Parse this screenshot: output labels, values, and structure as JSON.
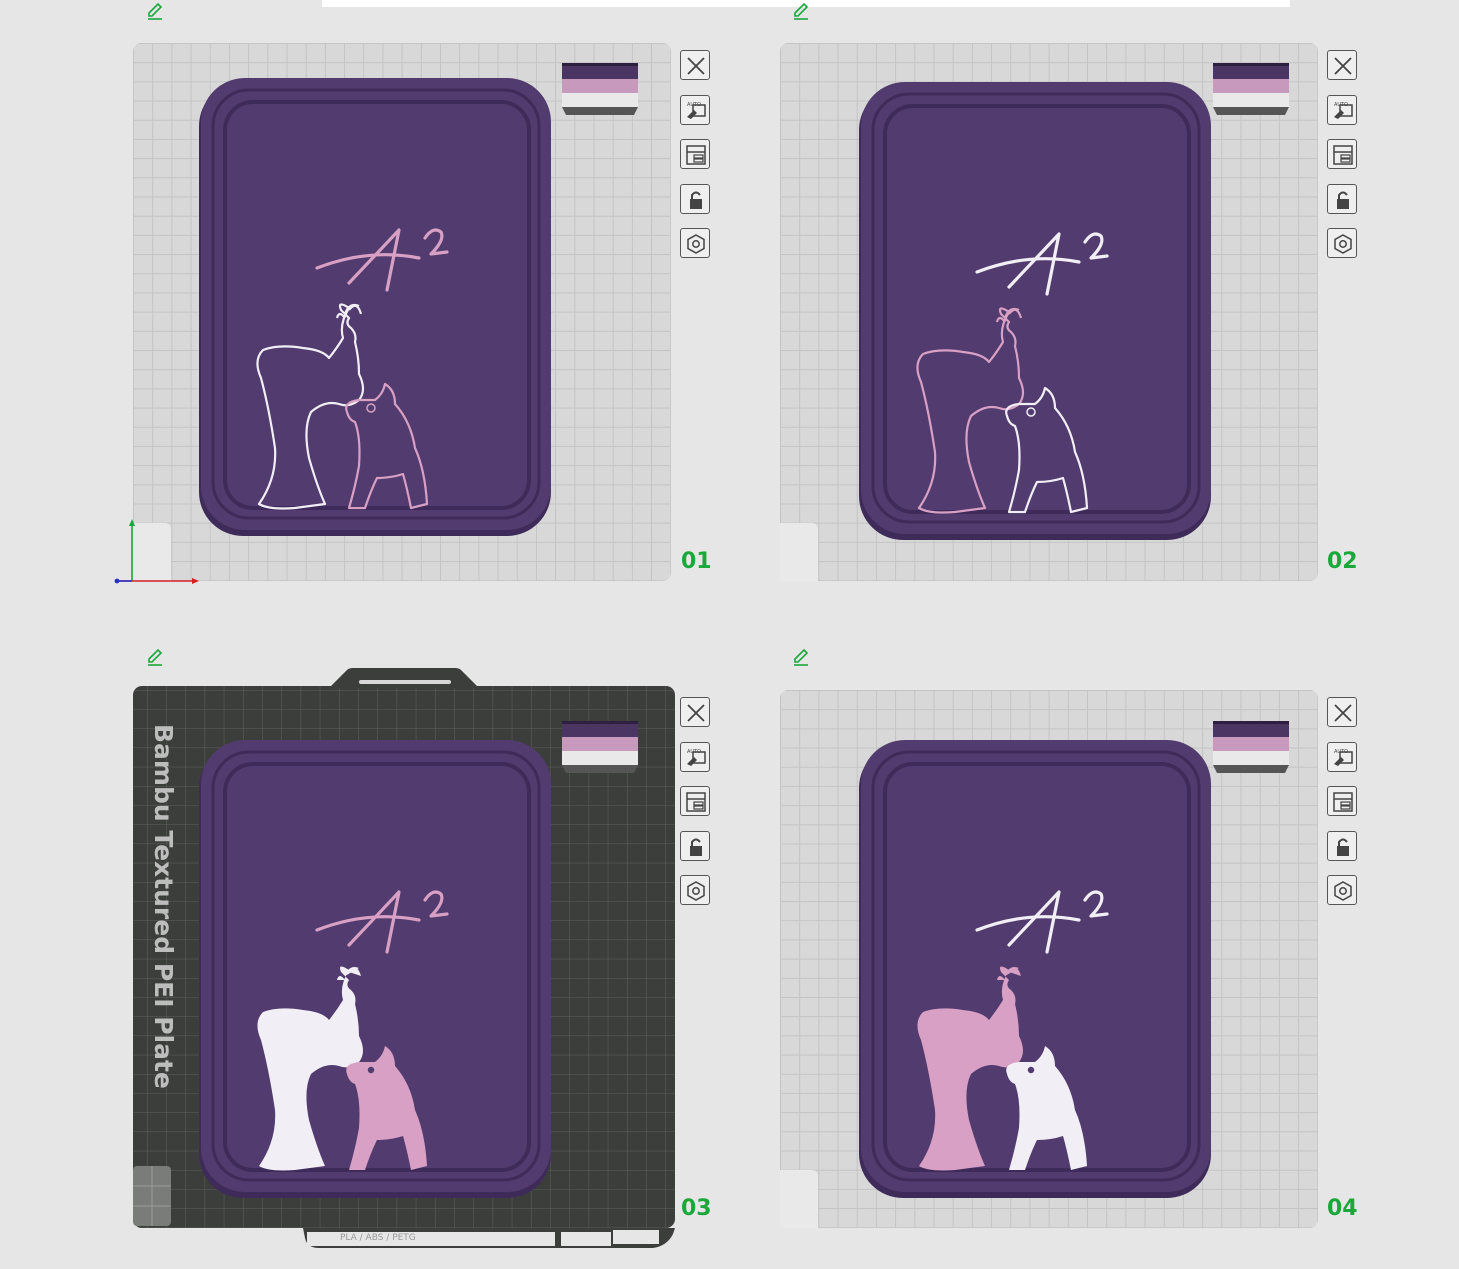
{
  "colors": {
    "tray": "#523b6e",
    "tray_rim": "#3f2b5a",
    "pink": "#d7a0c4",
    "white": "#f2eef6",
    "accent_number": "#1aa83a"
  },
  "plates": [
    {
      "number": "01",
      "plate_type": "",
      "filament_order": [
        "#4a3563",
        "#c79abd",
        "#e9e9e9"
      ],
      "logo_color": "pink",
      "figure_style": "outline",
      "person_color": "white",
      "dog_color": "pink"
    },
    {
      "number": "02",
      "plate_type": "",
      "filament_order": [
        "#4a3563",
        "#c79abd",
        "#e9e9e9"
      ],
      "logo_color": "white",
      "figure_style": "outline",
      "person_color": "pink",
      "dog_color": "white"
    },
    {
      "number": "03",
      "plate_type": "Bambu Textured PEI Plate",
      "filament_order": [
        "#4a3563",
        "#c79abd",
        "#e9e9e9"
      ],
      "logo_color": "pink",
      "figure_style": "filled",
      "person_color": "white",
      "dog_color": "pink"
    },
    {
      "number": "04",
      "plate_type": "",
      "filament_order": [
        "#4a3563",
        "#c79abd",
        "#e9e9e9"
      ],
      "logo_color": "white",
      "figure_style": "filled",
      "person_color": "pink",
      "dog_color": "white"
    }
  ],
  "toolbar": [
    "close-icon",
    "auto-orient-icon",
    "arrange-icon",
    "lock-icon",
    "settings-icon"
  ],
  "plate3_footer": {
    "material": "PLA / ABS / PETG"
  }
}
